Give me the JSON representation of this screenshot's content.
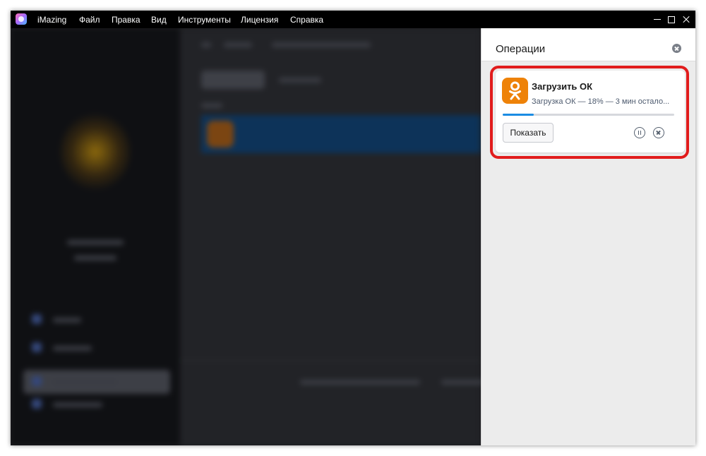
{
  "app": {
    "title": "iMazing",
    "logo_icon": "imazing-logo-icon"
  },
  "menu": {
    "items": [
      {
        "label": "Файл"
      },
      {
        "label": "Правка"
      },
      {
        "label": "Вид"
      },
      {
        "label": "Инструменты"
      },
      {
        "label": "Лицензия"
      },
      {
        "label": "Справка"
      }
    ]
  },
  "window_controls": {
    "minimize_icon": "minimize-icon",
    "maximize_icon": "maximize-icon",
    "close_icon": "close-icon"
  },
  "operations": {
    "title": "Операции",
    "close_icon": "close-circle-icon",
    "task": {
      "app_icon": "odnoklassniki-icon",
      "title": "Загрузить ОК",
      "status": "Загрузка ОК — 18% — 3 мин остало...",
      "progress_percent": 18,
      "show_label": "Показать",
      "pause_icon": "pause-circle-icon",
      "cancel_icon": "cancel-circle-icon"
    }
  },
  "colors": {
    "highlight": "#e11c1c",
    "progress": "#1b8ce3",
    "ok_orange": "#ee8208",
    "titlebar": "#000000"
  }
}
